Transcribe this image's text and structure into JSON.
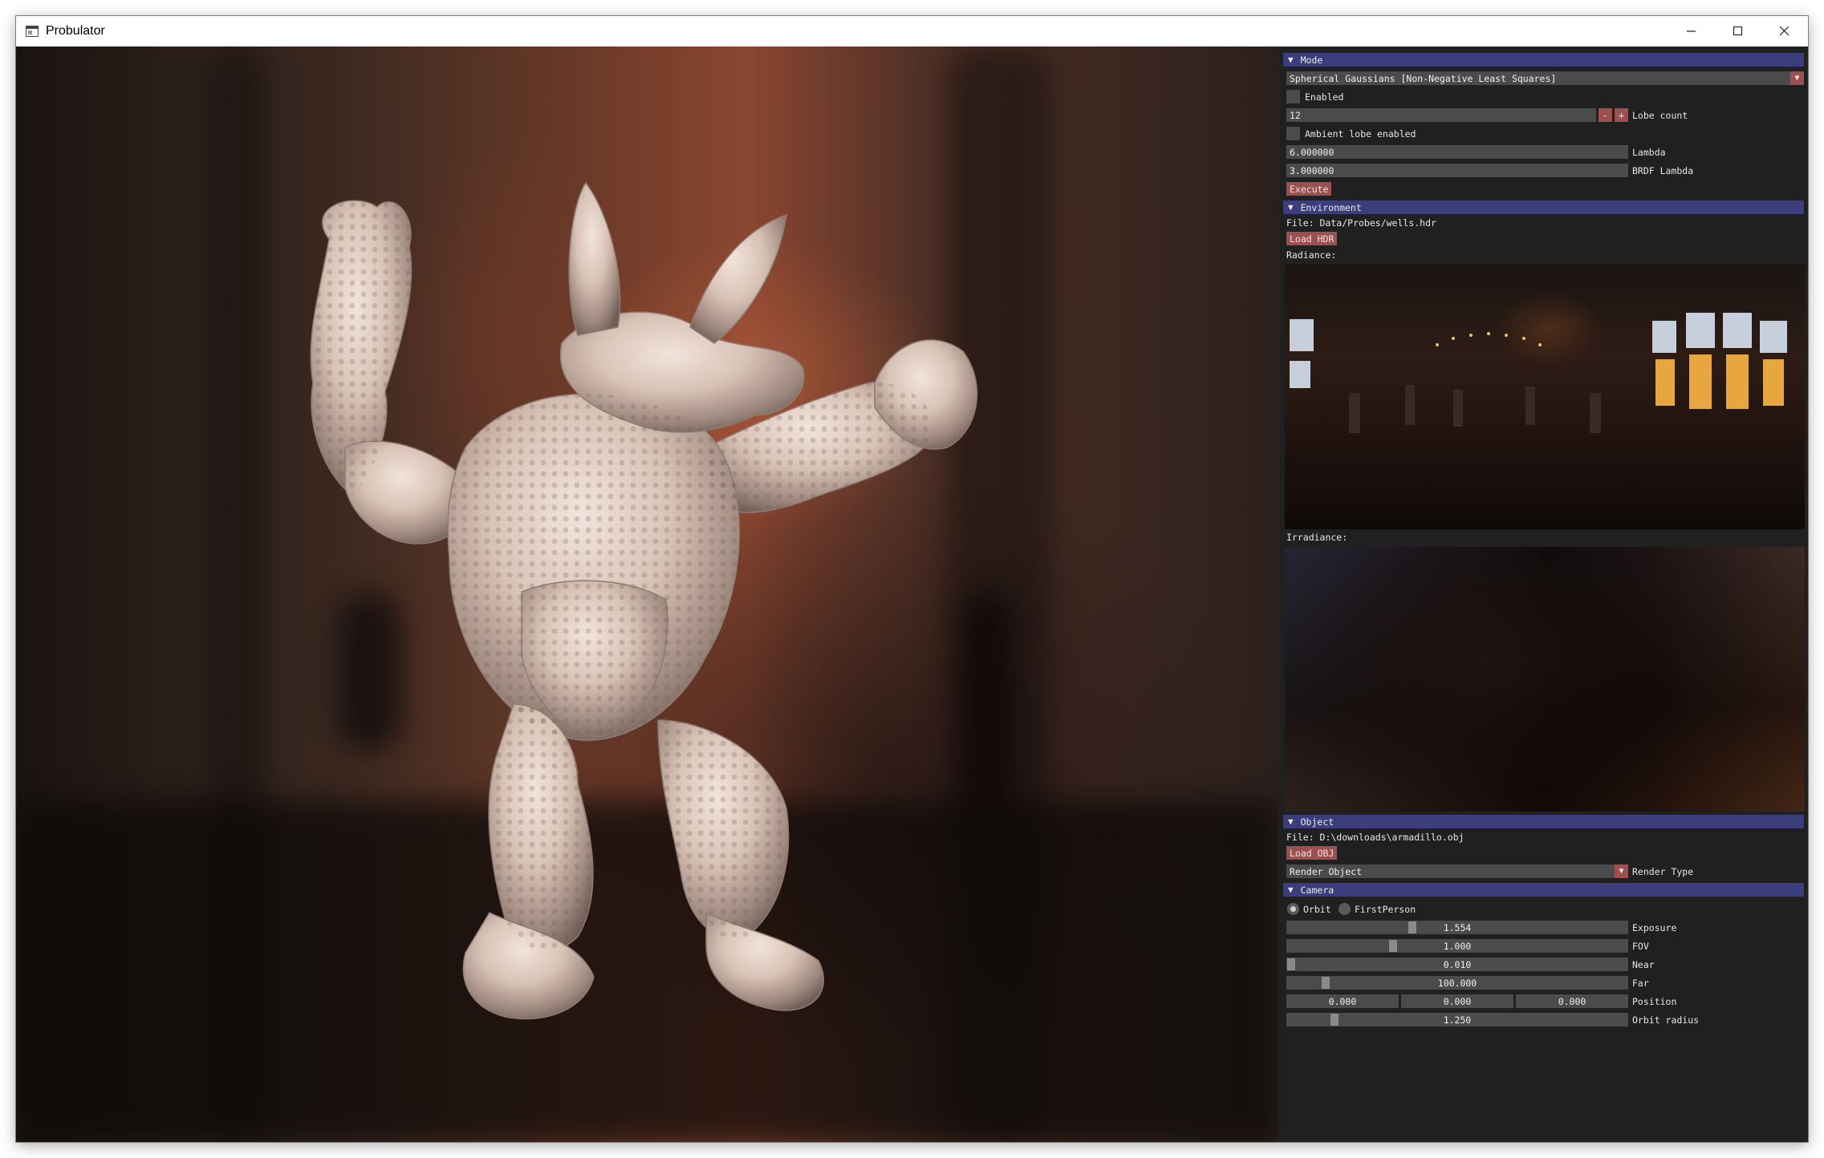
{
  "window": {
    "title": "Probulator"
  },
  "panel": {
    "mode": {
      "header": "Mode",
      "method": "Spherical Gaussians [Non-Negative Least Squares]",
      "enabled_label": "Enabled",
      "lobe_count_value": "12",
      "lobe_count_label": "Lobe count",
      "minus": "-",
      "plus": "+",
      "ambient_label": "Ambient lobe enabled",
      "lambda_value": "6.000000",
      "lambda_label": "Lambda",
      "brdf_lambda_value": "3.000000",
      "brdf_lambda_label": "BRDF Lambda",
      "execute_label": "Execute"
    },
    "environment": {
      "header": "Environment",
      "file_text": "File: Data/Probes/wells.hdr",
      "load_label": "Load HDR",
      "radiance_label": "Radiance:",
      "irradiance_label": "Irradiance:"
    },
    "object": {
      "header": "Object",
      "file_text": "File: D:\\downloads\\armadillo.obj",
      "load_label": "Load OBJ",
      "render_type_value": "Render Object",
      "render_type_label": "Render Type"
    },
    "camera": {
      "header": "Camera",
      "mode_orbit": "Orbit",
      "mode_firstperson": "FirstPerson",
      "selected_mode": "Orbit",
      "exposure_value": "1.554",
      "exposure_label": "Exposure",
      "fov_value": "1.000",
      "fov_label": "FOV",
      "near_value": "0.010",
      "near_label": "Near",
      "far_value": "100.000",
      "far_label": "Far",
      "position_x": "0.000",
      "position_y": "0.000",
      "position_z": "0.000",
      "position_label": "Position",
      "orbit_radius_value": "1.250",
      "orbit_radius_label": "Orbit radius"
    }
  },
  "icons": {
    "app": "app-window-icon",
    "minimize": "minimize-icon",
    "maximize": "maximize-icon",
    "close": "close-icon",
    "collapse": "triangle-down-icon",
    "dropdown": "triangle-down-icon"
  },
  "colors": {
    "header_blue": "#3b3d7c",
    "button_red": "#9c5050",
    "panel_bg": "#202020",
    "field_bg": "#4b4b4b"
  }
}
